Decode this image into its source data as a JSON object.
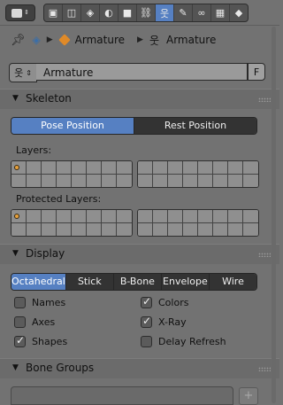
{
  "header": {
    "editor_type_icon": "properties-editor-icon",
    "context_tabs": [
      {
        "name": "render",
        "glyph": "▣",
        "active": false
      },
      {
        "name": "render-layers",
        "glyph": "◫",
        "active": false
      },
      {
        "name": "scene",
        "glyph": "◈",
        "active": false
      },
      {
        "name": "world",
        "glyph": "◐",
        "active": false
      },
      {
        "name": "object",
        "glyph": "■",
        "active": false
      },
      {
        "name": "constraints",
        "glyph": "⛓",
        "active": false
      },
      {
        "name": "armature-data",
        "glyph": "웃",
        "active": true
      },
      {
        "name": "bone",
        "glyph": "✎",
        "active": false
      },
      {
        "name": "bone-constraints",
        "glyph": "∞",
        "active": false
      },
      {
        "name": "texture",
        "glyph": "▦",
        "active": false
      },
      {
        "name": "physics",
        "glyph": "◆",
        "active": false
      }
    ]
  },
  "breadcrumb": {
    "object_name": "Armature",
    "data_name": "Armature"
  },
  "datablock": {
    "name": "Armature",
    "fake_user_label": "F"
  },
  "skeleton": {
    "title": "Skeleton",
    "pose_position": "Pose Position",
    "rest_position": "Rest Position",
    "selected_position": "Pose Position",
    "layers_label": "Layers:",
    "protected_layers_label": "Protected Layers:"
  },
  "display": {
    "title": "Display",
    "draw_types": [
      "Octahedral",
      "Stick",
      "B-Bone",
      "Envelope",
      "Wire"
    ],
    "selected_draw_type": "Octahedral",
    "options": {
      "names": {
        "label": "Names",
        "checked": false
      },
      "colors": {
        "label": "Colors",
        "checked": true
      },
      "axes": {
        "label": "Axes",
        "checked": false
      },
      "xray": {
        "label": "X-Ray",
        "checked": true
      },
      "shapes": {
        "label": "Shapes",
        "checked": true
      },
      "delay_refresh": {
        "label": "Delay Refresh",
        "checked": false
      }
    }
  },
  "bone_groups": {
    "title": "Bone Groups",
    "add_label": "+"
  },
  "colors": {
    "accent": "#5680c2",
    "background": "#727272",
    "panel_header": "#6b6b6b",
    "armature_icon": "#e08a28"
  }
}
